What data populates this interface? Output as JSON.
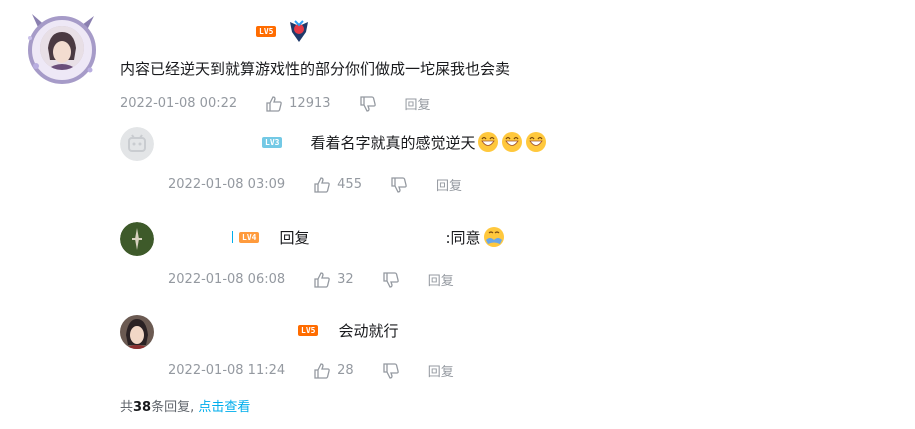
{
  "main": {
    "level": "LV5",
    "text": "内容已经逆天到就算游戏性的部分你们做成一坨屎我也会卖",
    "time": "2022-01-08 00:22",
    "likes": "12913",
    "reply": "回复"
  },
  "replies": [
    {
      "level": "LV3",
      "text": "看着名字就真的感觉逆天",
      "emoji_count": 3,
      "time": "2022-01-08 03:09",
      "likes": "455",
      "reply": "回复"
    },
    {
      "level": "LV4",
      "reply_prefix": "回复",
      "text": ":同意",
      "time": "2022-01-08 06:08",
      "likes": "32",
      "reply": "回复"
    },
    {
      "level": "LV5",
      "text": "会动就行",
      "time": "2022-01-08 11:24",
      "likes": "28",
      "reply": "回复"
    }
  ],
  "footer": {
    "prefix": "共",
    "count": "38",
    "suffix": "条回复,",
    "view_more": "点击查看"
  },
  "colors": {
    "lv5": "#ff6c00",
    "lv4": "#ff9b3d",
    "lv3": "#73c9e5",
    "meta": "#9499a0",
    "link": "#00aeec"
  }
}
